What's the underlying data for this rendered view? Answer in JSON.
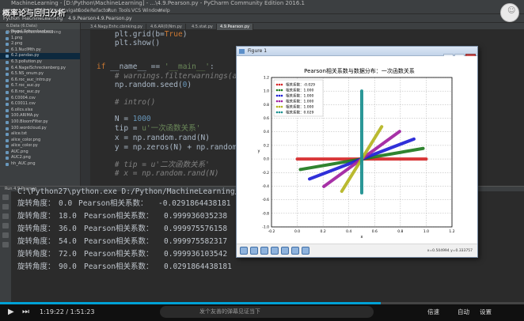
{
  "watermark": "概率论与回归分析",
  "ide": {
    "title": "MachineLearning - [D:\\Python\\MachineLearning] - ...\\4.9.Pearson.py - PyCharm Community Edition 2016.1",
    "menu": [
      "File",
      "Edit",
      "View",
      "Navigate",
      "Code",
      "Refactor",
      "Run",
      "Tools",
      "VCS",
      "Window",
      "Help"
    ],
    "path": [
      "Python",
      "MachineLearning",
      "4.9.Pearson",
      "4.9.Pearson.py"
    ],
    "project_header": "6.Data (6.Data) D:\\Python\\MachineLearning",
    "files": [
      "Nagel Schreckenberg",
      "1.png",
      "2.png",
      "6.1.NuclMth.py",
      "6.2.pandas.py",
      "6.3.pollution.py",
      "6.4.NagelSchreckenberg.py",
      "6.5.NS_onum.py",
      "6.6.roc_auc_intro.py",
      "6.7.roc_auc.py",
      "6.8.roc_auc.py",
      "6.C0004.csv",
      "6.C0011.csv",
      "6.ollcs.xlsx",
      "100.ARIMA.py",
      "100.BloomFilter.py",
      "100.wordcloud.py",
      "alice.txt",
      "alice_color.png",
      "alice_color.py",
      "AUC.png",
      "AUC2.png",
      "hh_AUC.png"
    ],
    "tabs": [
      "3.4.Nagy.Enhc.cbinking.py",
      "4.6.AR(0)Nm.py",
      "4.5.stat.py",
      "4.9.Pearson.py"
    ],
    "active_tab": 3
  },
  "code": {
    "l1_a": "    plt.grid(b=",
    "l1_b": "True",
    "l1_c": ")",
    "l2": "    plt.show()",
    "l3_kw1": "if",
    "l3_a": " __name__ == ",
    "l3_str": "'__main__'",
    "l3_b": ":",
    "l4": "    # warnings.filterwarnings(acti",
    "l5_a": "    np.random.seed(",
    "l5_num": "0",
    "l5_b": ")",
    "l6": "    # intro()",
    "l7_a": "    N = ",
    "l7_num": "1000",
    "l8_a": "    tip = ",
    "l8_str": "u'一次函数关系'",
    "l9": "    x = np.random.rand(N)",
    "l10": "    y = np.zeros(N) + np.random.ra",
    "l11": "    # tip = u'二次函数关系'",
    "l12": "    # x = np.random.rand(N)"
  },
  "console": {
    "header": "Run  4.9.Pearson",
    "command": "C:\\Python27\\python.exe D:/Python/MachineLearning/4.Python",
    "rows": [
      {
        "label": "旋转角度：",
        "angle": "0.0",
        "pl": "Pearson相关系数：",
        "coef": "-0.0291864438181"
      },
      {
        "label": "旋转角度：",
        "angle": "18.0",
        "pl": "Pearson相关系数：",
        "coef": "0.999936035238"
      },
      {
        "label": "旋转角度：",
        "angle": "36.0",
        "pl": "Pearson相关系数：",
        "coef": "0.999975576158"
      },
      {
        "label": "旋转角度：",
        "angle": "54.0",
        "pl": "Pearson相关系数：",
        "coef": "0.999975582317"
      },
      {
        "label": "旋转角度：",
        "angle": "72.0",
        "pl": "Pearson相关系数：",
        "coef": "0.999936103542"
      },
      {
        "label": "旋转角度：",
        "angle": "90.0",
        "pl": "Pearson相关系数：",
        "coef": "0.0291864438181"
      }
    ]
  },
  "figure": {
    "window_title": "Figure 1",
    "minimize": "–",
    "maximize": "□",
    "close": "✕",
    "coords": "x=0.504994   y=0.333757"
  },
  "chart_data": {
    "type": "scatter",
    "title": "Pearson相关系数与数据分布：一次函数关系",
    "xlabel": "x",
    "ylabel": "y",
    "xlim": [
      -0.2,
      1.2
    ],
    "ylim": [
      -1.0,
      1.2
    ],
    "xticks": [
      "-0.2",
      "0.0",
      "0.2",
      "0.4",
      "0.6",
      "0.8",
      "1.0",
      "1.2"
    ],
    "yticks": [
      "-1.0",
      "-0.8",
      "-0.6",
      "-0.4",
      "-0.2",
      "0.0",
      "0.2",
      "0.4",
      "0.6",
      "0.8",
      "1.0",
      "1.2"
    ],
    "grid": true,
    "legend_position": "top-left",
    "series": [
      {
        "name": "相关系数：-0.029",
        "color": "#d62728",
        "angle_deg": 0,
        "x0": 0.0,
        "x1": 1.0,
        "y0": 0.0,
        "y1": 0.0
      },
      {
        "name": "相关系数：1.000",
        "color": "#1f7a1f",
        "angle_deg": 18,
        "x0": 0.024,
        "x1": 0.976,
        "y0": -0.155,
        "y1": 0.155
      },
      {
        "name": "相关系数：1.000",
        "color": "#1f1fd6",
        "angle_deg": 36,
        "x0": 0.095,
        "x1": 0.905,
        "y0": -0.294,
        "y1": 0.294
      },
      {
        "name": "相关系数：1.000",
        "color": "#a020a0",
        "angle_deg": 54,
        "x0": 0.206,
        "x1": 0.794,
        "y0": -0.405,
        "y1": 0.405
      },
      {
        "name": "相关系数：1.000",
        "color": "#b5b520",
        "angle_deg": 72,
        "x0": 0.345,
        "x1": 0.655,
        "y0": -0.476,
        "y1": 0.476
      },
      {
        "name": "相关系数：0.029",
        "color": "#1a8f8f",
        "angle_deg": 90,
        "x0": 0.5,
        "x1": 0.5,
        "y0": -0.5,
        "y1": 1.0
      }
    ]
  },
  "player": {
    "progress": 0.726,
    "time_current": "1:19:22",
    "time_sep": " / ",
    "time_total": "1:51:23",
    "danmu_placeholder": "发个友善的弹幕见证当下",
    "quality": "自动",
    "speed": "倍速",
    "play_icon": "▶",
    "next_icon": "⏭",
    "settings_text": "设置",
    "avatar_glyph": "☺"
  }
}
